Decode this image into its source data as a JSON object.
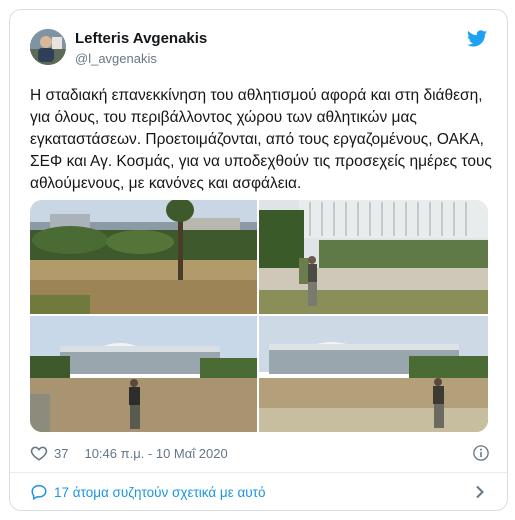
{
  "tweet": {
    "author_name": "Lefteris Avgenakis",
    "author_handle": "@l_avgenakis",
    "text": "Η σταδιακή επανεκκίνηση του αθλητισμού αφορά και στη διάθεση, για όλους, του περιβάλλοντος χώρου των αθλητικών μας εγκαταστάσεων. Προετοιμάζονται, από τους εργαζομένους, ΟΑΚΑ, ΣΕΦ και Αγ. Κοσμάς, για να υποδεχθούν τις προσεχείς ημέρες τους αθλούμενους, με κανόνες και ασφάλεια.",
    "like_count": "37",
    "timestamp": "10:46 π.μ. - 10 Μαΐ 2020"
  },
  "footer": {
    "conversation_label": "17 άτομα συζητούν σχετικά με αυτό"
  },
  "icons": {
    "brand": "twitter-bird-icon",
    "like": "heart-icon",
    "info": "info-icon",
    "reply": "comment-icon",
    "chevron": "chevron-right-icon"
  },
  "colors": {
    "brand_blue": "#1da1f2",
    "link_blue": "#1b95e0",
    "secondary_text": "#657786",
    "border": "#d9dee2"
  }
}
